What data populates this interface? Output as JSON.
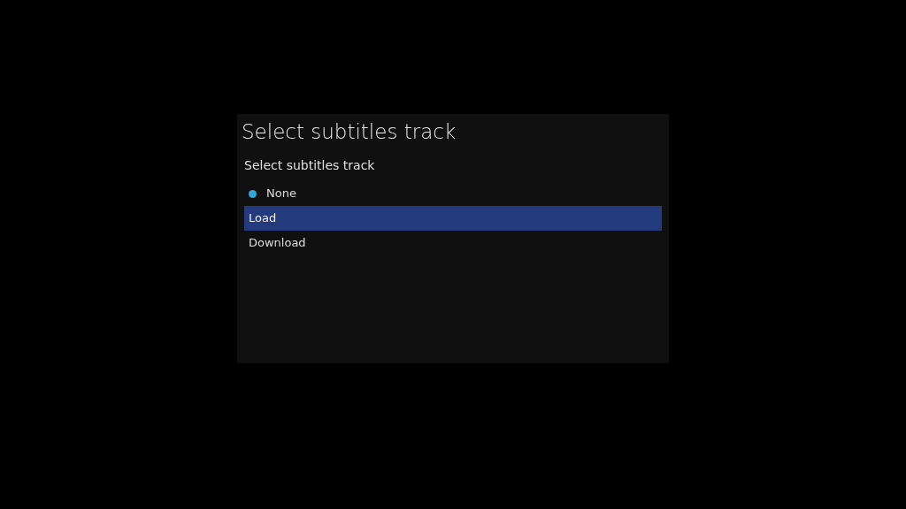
{
  "dialog": {
    "title": "Select subtitles track",
    "heading": "Select subtitles track",
    "items": [
      {
        "label": "None",
        "checked": true,
        "selected": false
      },
      {
        "label": "Load",
        "checked": false,
        "selected": true
      },
      {
        "label": "Download",
        "checked": false,
        "selected": false
      }
    ]
  }
}
